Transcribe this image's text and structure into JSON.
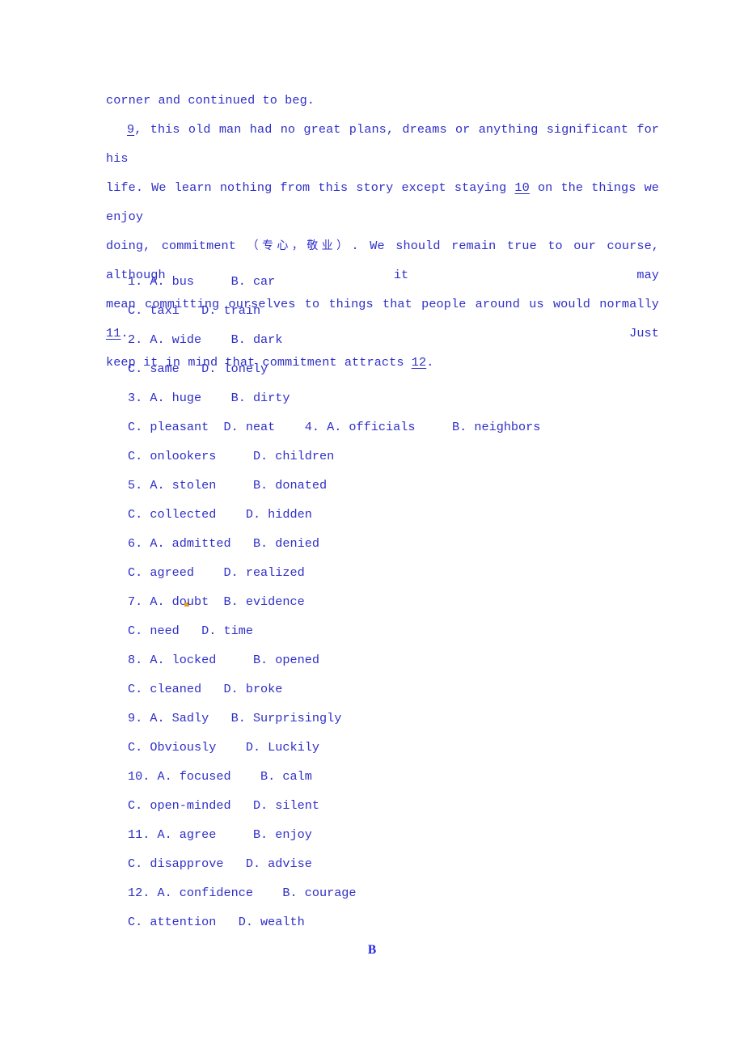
{
  "document": {
    "type": "english-cloze-worksheet",
    "text_color": "#2f2fc8",
    "background_color": "#ffffff",
    "passage": {
      "line1": "corner and continued to beg.",
      "line2_blank": "9",
      "line2_before": "",
      "line2_after": ",  this old man had no great plans, dreams or anything significant for his",
      "line3_before": "life. We learn nothing from this story except staying ",
      "line3_blank": "10",
      "line3_after": " on the things we enjoy",
      "line4_before": "doing, commitment ",
      "line4_cn": "（专心，敬业）",
      "line4_after": ". We should remain true to our course, although it may",
      "line5_before": "mean committing ourselves to things that people around us would normally ",
      "line5_blank": "11",
      "line5_after": ". Just",
      "line6_before": "keep it in mind that commitment attracts ",
      "line6_blank": "12",
      "line6_after": "."
    },
    "options": [
      {
        "line": "1. A. bus     B. car",
        "style": "num"
      },
      {
        "line": "C. taxi   D. train",
        "style": "cont"
      },
      {
        "line": "2. A. wide    B. dark",
        "style": "num"
      },
      {
        "line": "C. same   D. lonely",
        "style": "cont"
      },
      {
        "line": "3. A. huge    B. dirty",
        "style": "num"
      },
      {
        "line": "C. pleasant  D. neat    4. A. officials     B. neighbors",
        "style": "cont"
      },
      {
        "line": "C. onlookers     D. children",
        "style": "cont"
      },
      {
        "line": "5. A. stolen     B. donated",
        "style": "num"
      },
      {
        "line": "C. collected    D. hidden",
        "style": "cont"
      },
      {
        "line": "6. A. admitted   B. denied",
        "style": "num"
      },
      {
        "line": "C. agreed    D. realized",
        "style": "cont"
      },
      {
        "line": "7. A. doubt  B. evidence",
        "style": "num",
        "artifact": true
      },
      {
        "line": "C. need   D. time",
        "style": "cont"
      },
      {
        "line": "8. A. locked     B. opened",
        "style": "num"
      },
      {
        "line": "C. cleaned   D. broke",
        "style": "cont"
      },
      {
        "line": "9. A. Sadly   B. Surprisingly",
        "style": "num"
      },
      {
        "line": "C. Obviously    D. Luckily",
        "style": "cont"
      },
      {
        "line": "10. A. focused    B. calm",
        "style": "num"
      },
      {
        "line": "C. open-minded   D. silent",
        "style": "cont"
      },
      {
        "line": "11. A. agree     B. enjoy",
        "style": "num"
      },
      {
        "line": "C. disapprove   D. advise",
        "style": "cont"
      },
      {
        "line": "12. A. confidence    B. courage",
        "style": "num"
      },
      {
        "line": "C. attention   D. wealth",
        "style": "cont"
      }
    ],
    "section_marker": "B"
  }
}
